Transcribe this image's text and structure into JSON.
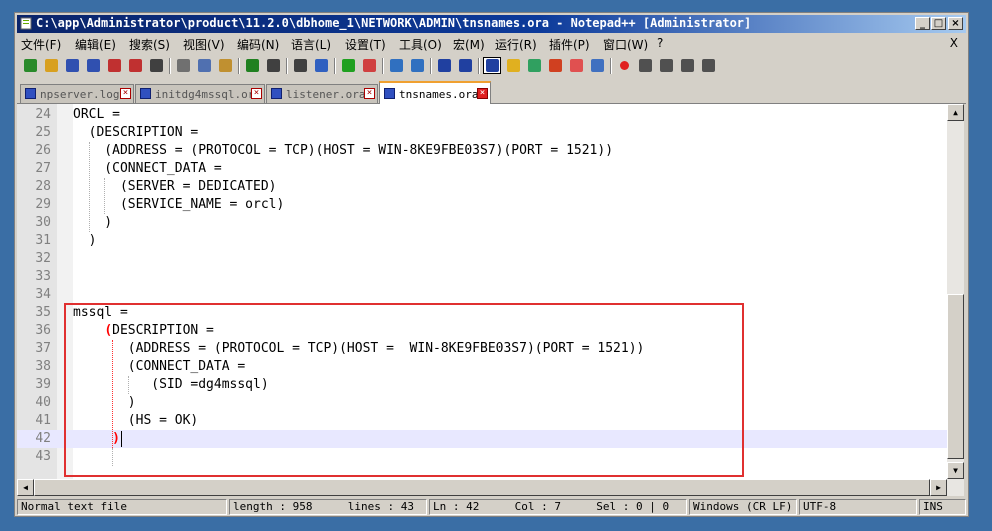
{
  "window": {
    "title": "C:\\app\\Administrator\\product\\11.2.0\\dbhome_1\\NETWORK\\ADMIN\\tnsnames.ora - Notepad++ [Administrator]"
  },
  "menu": {
    "items": [
      "文件(F)",
      "编辑(E)",
      "搜索(S)",
      "视图(V)",
      "编码(N)",
      "语言(L)",
      "设置(T)",
      "工具(O)",
      "宏(M)",
      "运行(R)",
      "插件(P)",
      "窗口(W)",
      "?"
    ],
    "close_doc": "X"
  },
  "toolbar": {
    "icons": [
      "new-file-icon",
      "open-file-icon",
      "save-icon",
      "save-all-icon",
      "close-icon",
      "close-all-icon",
      "print-icon",
      "cut-icon",
      "copy-icon",
      "paste-icon",
      "undo-icon",
      "redo-icon",
      "find-icon",
      "replace-icon",
      "zoom-in-icon",
      "zoom-out-icon",
      "sync-vertical-icon",
      "sync-horizontal-icon",
      "word-wrap-icon",
      "show-all-chars-icon",
      "indent-guide-icon",
      "udl-icon",
      "doc-map-icon",
      "function-list-icon",
      "folder-workspace-icon",
      "monitor-icon",
      "record-macro-icon",
      "stop-record-icon",
      "play-macro-icon",
      "run-macro-multiple-icon",
      "save-macro-icon"
    ]
  },
  "tabs": [
    {
      "label": "npserver.log"
    },
    {
      "label": "initdg4mssql.ora"
    },
    {
      "label": "listener.ora"
    },
    {
      "label": "tnsnames.ora",
      "active": true
    }
  ],
  "editor": {
    "lines": [
      {
        "n": "24",
        "text": "ORCL ="
      },
      {
        "n": "25",
        "text": "  (DESCRIPTION ="
      },
      {
        "n": "26",
        "text": "    (ADDRESS = (PROTOCOL = TCP)(HOST = WIN-8KE9FBE03S7)(PORT = 1521))"
      },
      {
        "n": "27",
        "text": "    (CONNECT_DATA ="
      },
      {
        "n": "28",
        "text": "      (SERVER = DEDICATED)"
      },
      {
        "n": "29",
        "text": "      (SERVICE_NAME = orcl)"
      },
      {
        "n": "30",
        "text": "    )"
      },
      {
        "n": "31",
        "text": "  )"
      },
      {
        "n": "32",
        "text": ""
      },
      {
        "n": "33",
        "text": ""
      },
      {
        "n": "34",
        "text": ""
      },
      {
        "n": "35",
        "text": "mssql ="
      },
      {
        "n": "36",
        "pre": "    ",
        "bm": "(",
        "text": "DESCRIPTION ="
      },
      {
        "n": "37",
        "text": "       (ADDRESS = (PROTOCOL = TCP)(HOST =  WIN-8KE9FBE03S7)(PORT = 1521))"
      },
      {
        "n": "38",
        "text": "       (CONNECT_DATA ="
      },
      {
        "n": "39",
        "text": "          (SID =dg4mssql)"
      },
      {
        "n": "40",
        "text": "       )"
      },
      {
        "n": "41",
        "text": "       (HS = OK)"
      },
      {
        "n": "42",
        "pre": "     ",
        "bm": ")",
        "text": ""
      },
      {
        "n": "43",
        "text": ""
      }
    ]
  },
  "status": {
    "file_type": "Normal text file",
    "length": "length : 958",
    "lines": "lines : 43",
    "ln": "Ln : 42",
    "col": "Col : 7",
    "sel": "Sel : 0 | 0",
    "eol": "Windows (CR LF)",
    "encoding": "UTF-8",
    "mode": "INS"
  },
  "colors": {
    "title_bar": "#0a246a",
    "highlight_box": "#e03030",
    "brace_match": "#ff0000",
    "current_line": "#e8e8ff"
  }
}
